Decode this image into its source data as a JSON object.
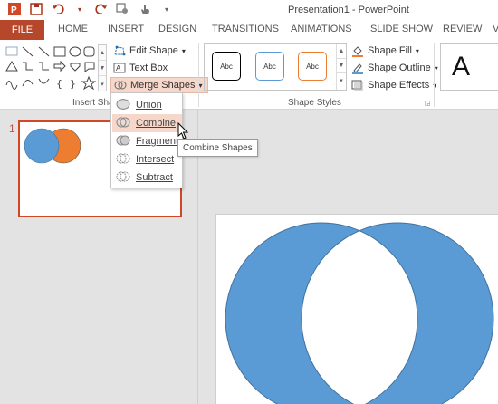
{
  "window": {
    "title": "Presentation1 - PowerPoint"
  },
  "quick_access": {
    "icons": [
      "powerpoint-icon",
      "save-icon",
      "undo-icon",
      "redo-icon",
      "touch-mode-icon"
    ]
  },
  "tabs": [
    {
      "label": "FILE"
    },
    {
      "label": "HOME"
    },
    {
      "label": "INSERT"
    },
    {
      "label": "DESIGN"
    },
    {
      "label": "TRANSITIONS"
    },
    {
      "label": "ANIMATIONS"
    },
    {
      "label": "SLIDE SHOW"
    },
    {
      "label": "REVIEW"
    },
    {
      "label": "V"
    }
  ],
  "ribbon": {
    "insert_shapes": {
      "label": "Insert Sha",
      "edit_shape": "Edit Shape",
      "text_box": "Text Box",
      "merge_shapes": "Merge Shapes"
    },
    "shape_styles": {
      "label": "Shape Styles",
      "styles": [
        "Abc",
        "Abc",
        "Abc"
      ],
      "style_colors": [
        "#000000",
        "#5b9bd5",
        "#ed7d31"
      ],
      "shape_fill": "Shape Fill",
      "shape_outline": "Shape Outline",
      "shape_effects": "Shape Effects"
    },
    "wordart": {
      "letter": "A"
    }
  },
  "slides_pane": {
    "slide_number": "1"
  },
  "merge_menu": {
    "items": [
      {
        "label": "Union"
      },
      {
        "label": "Combine"
      },
      {
        "label": "Fragment"
      },
      {
        "label": "Intersect"
      },
      {
        "label": "Subtract"
      }
    ],
    "hovered": "Combine",
    "tooltip": "Combine Shapes"
  },
  "colors": {
    "accent": "#b7472a",
    "blue_shape": "#5b9bd5",
    "orange_shape": "#ed7d31",
    "highlight": "#f6d7ca"
  }
}
